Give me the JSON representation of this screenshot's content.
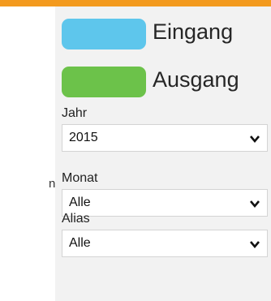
{
  "legend": [
    {
      "label": "Eingang",
      "color": "#5ec6ec"
    },
    {
      "label": "Ausgang",
      "color": "#6cc24a"
    }
  ],
  "filters": {
    "jahr": {
      "label": "Jahr",
      "value": "2015"
    },
    "monat": {
      "label": "Monat",
      "value": "Alle"
    },
    "alias": {
      "label": "Alias",
      "value": "Alle"
    }
  },
  "left_fragment": "n",
  "colors": {
    "accent": "#f39a1e"
  }
}
